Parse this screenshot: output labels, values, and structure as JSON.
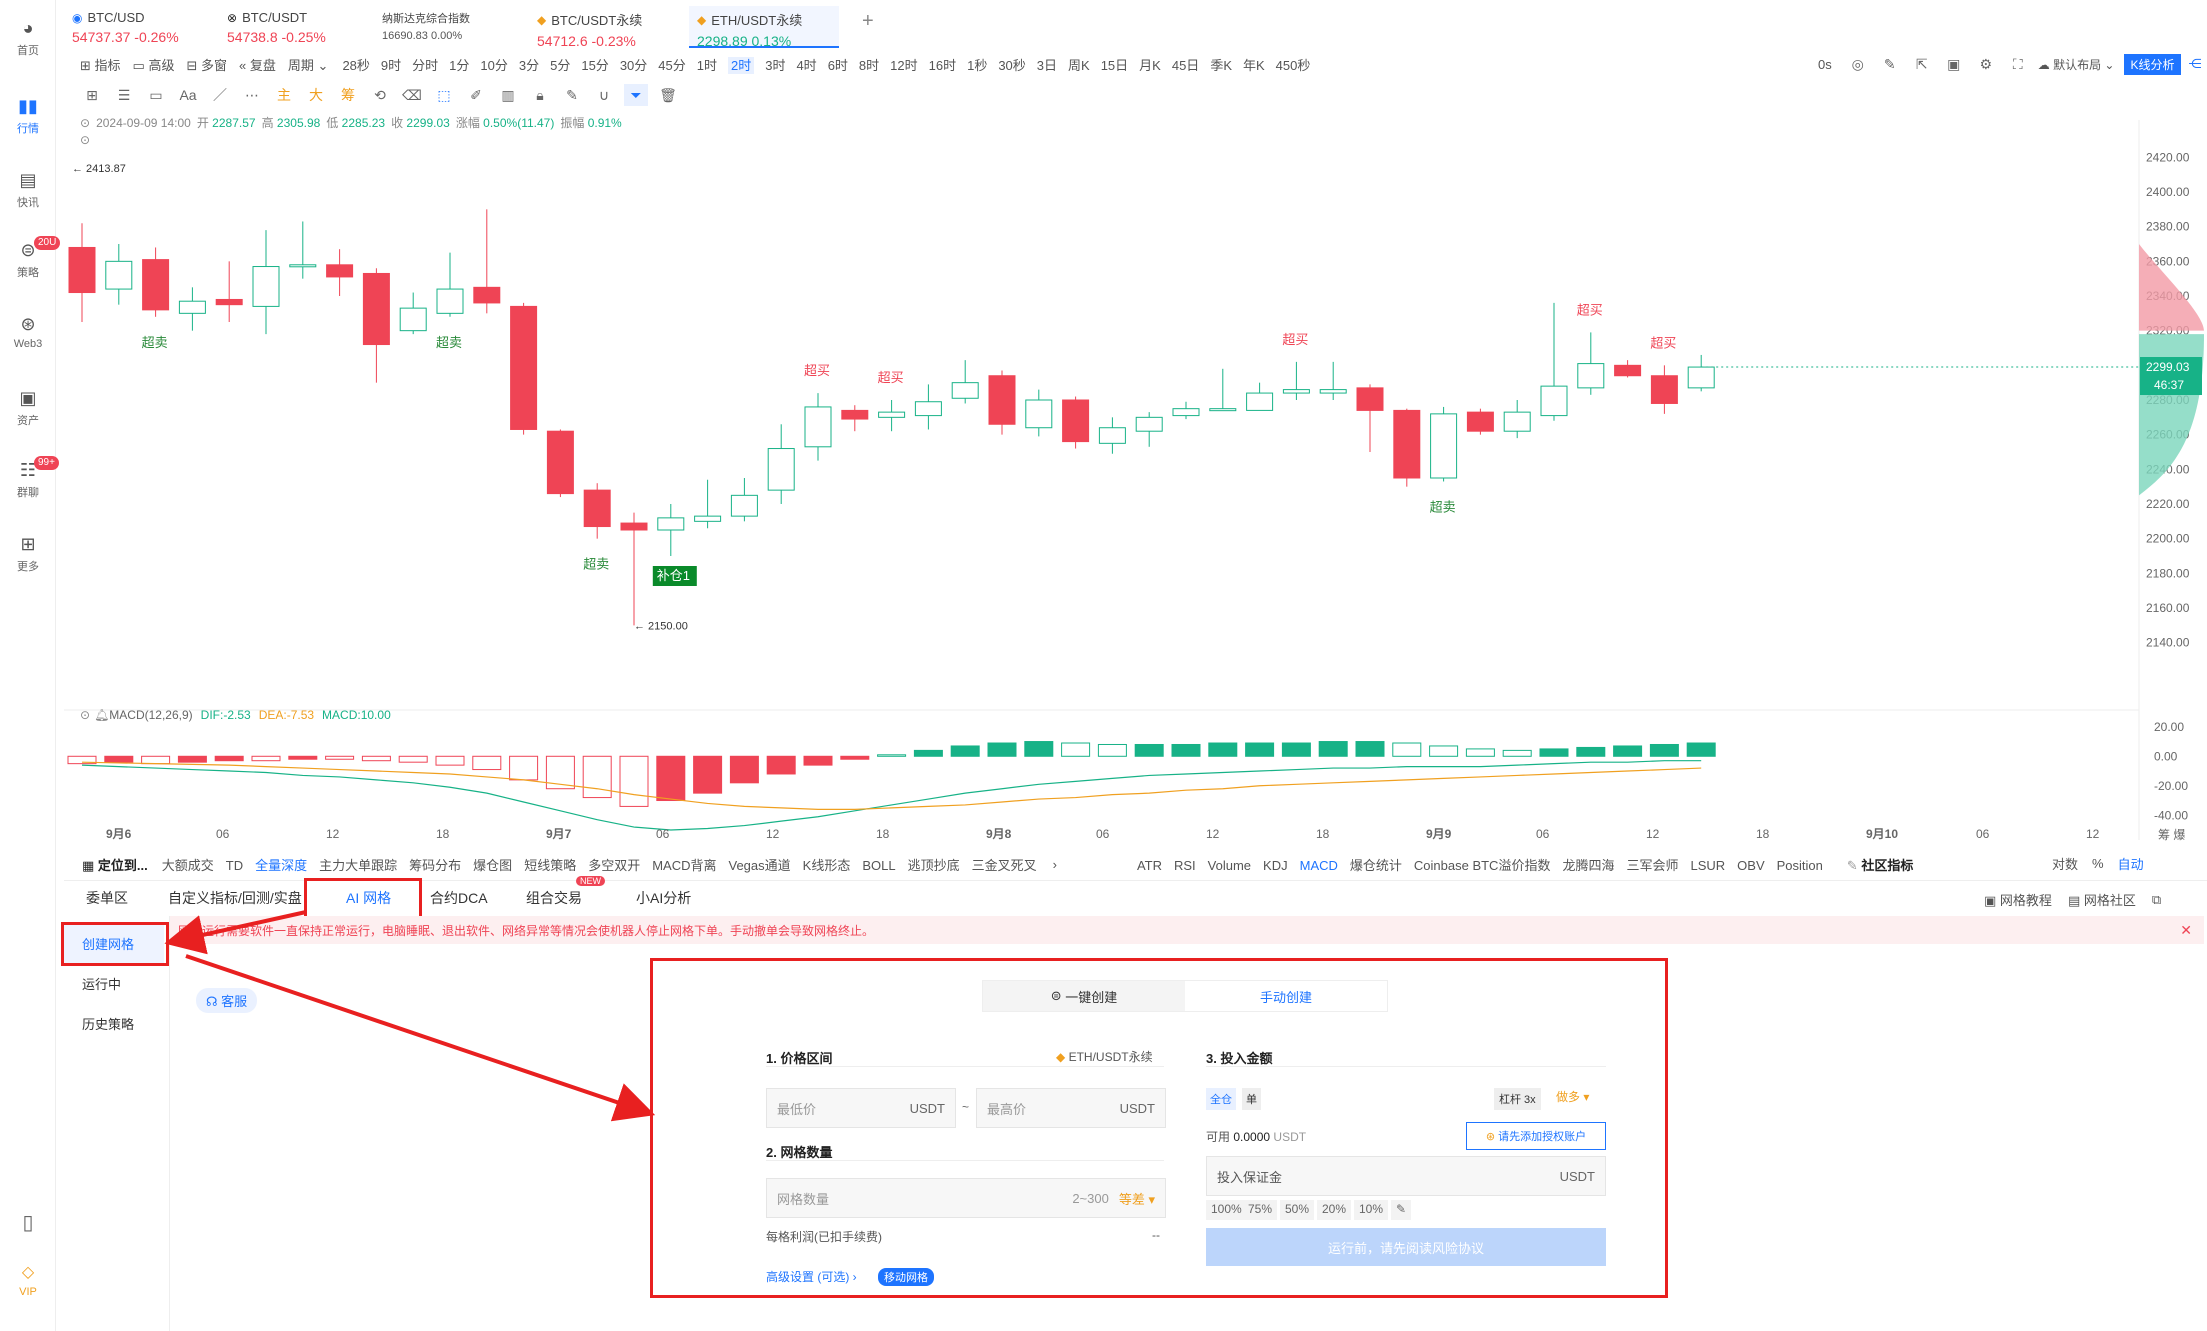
{
  "nav": [
    {
      "label": "首页",
      "icon": "home-icon"
    },
    {
      "label": "行情",
      "icon": "chart-bars-icon",
      "active": true
    },
    {
      "label": "快讯",
      "icon": "news-icon"
    },
    {
      "label": "策略",
      "icon": "robot-icon",
      "badge": "20U"
    },
    {
      "label": "Web3",
      "icon": "web3-icon"
    },
    {
      "label": "资产",
      "icon": "wallet-icon"
    },
    {
      "label": "群聊",
      "icon": "chat-icon",
      "badge": "99+"
    },
    {
      "label": "更多",
      "icon": "grid-icon"
    }
  ],
  "nav_bottom": {
    "vip": "VIP"
  },
  "tickers": [
    {
      "name": "BTC/USD",
      "price": "54737.37",
      "change": "-0.26%",
      "dir": "dn"
    },
    {
      "name": "BTC/USDT",
      "price": "54738.8",
      "change": "-0.25%",
      "dir": "dn"
    },
    {
      "name": "纳斯达克综合指数",
      "price": "16690.83",
      "change": "0.00%",
      "dir": "none"
    },
    {
      "name": "BTC/USDT永续",
      "price": "54712.6",
      "change": "-0.23%",
      "dir": "dn"
    },
    {
      "name": "ETH/USDT永续",
      "price": "2298.89",
      "change": "0.13%",
      "dir": "up",
      "active": true
    }
  ],
  "add_tab": "+",
  "toolbar1": {
    "indicators": "指标",
    "advanced": "高级",
    "multi": "多窗",
    "replay": "复盘",
    "period": "周期",
    "intervals": [
      "28秒",
      "9时",
      "分时",
      "1分",
      "10分",
      "3分",
      "5分",
      "15分",
      "30分",
      "45分",
      "1时",
      "2时",
      "3时",
      "4时",
      "6时",
      "8时",
      "12时",
      "16时",
      "1秒",
      "30秒",
      "3日",
      "周K",
      "15日",
      "月K",
      "45日",
      "季K",
      "年K",
      "450秒"
    ],
    "active_interval": "2时",
    "countdown": "0s",
    "layout": "默认布局",
    "kline_btn": "K线分析"
  },
  "toolbar2": {
    "t1": "Aa",
    "t2": "主",
    "t3": "大",
    "t4": "筹"
  },
  "ohlc": {
    "date": "2024-09-09 14:00",
    "open_l": "开",
    "open": "2287.57",
    "high_l": "高",
    "high": "2305.98",
    "low_l": "低",
    "low": "2285.23",
    "close_l": "收",
    "close": "2299.03",
    "chg_l": "涨幅",
    "chg": "0.50%(11.47)",
    "amp_l": "振幅",
    "amp": "0.91%"
  },
  "price_labels": {
    "high": "2413.87",
    "low": "2150.00",
    "current": "2299.03",
    "timer": "46:37"
  },
  "macd_header": {
    "name": "MACD(12,26,9)",
    "dif": "DIF:-2.53",
    "dea": "DEA:-7.53",
    "macd": "MACD:10.00"
  },
  "chart_data": {
    "type": "candlestick",
    "interval": "2h",
    "candles": [
      [
        2368,
        2342,
        2382,
        2325
      ],
      [
        2344,
        2360,
        2370,
        2335
      ],
      [
        2361,
        2332,
        2368,
        2328
      ],
      [
        2330,
        2337,
        2345,
        2320
      ],
      [
        2338,
        2335,
        2360,
        2325
      ],
      [
        2334,
        2357,
        2378,
        2318
      ],
      [
        2358,
        2358,
        2383,
        2350
      ],
      [
        2358,
        2351,
        2367,
        2340
      ],
      [
        2353,
        2312,
        2356,
        2290
      ],
      [
        2320,
        2333,
        2342,
        2318
      ],
      [
        2330,
        2344,
        2365,
        2328
      ],
      [
        2345,
        2336,
        2390,
        2330
      ],
      [
        2334,
        2263,
        2336,
        2260
      ],
      [
        2262,
        2226,
        2263,
        2224
      ],
      [
        2228,
        2207,
        2232,
        2200
      ],
      [
        2209,
        2205,
        2215,
        2150
      ],
      [
        2205,
        2212,
        2220,
        2190
      ],
      [
        2210,
        2213,
        2234,
        2206
      ],
      [
        2213,
        2225,
        2235,
        2210
      ],
      [
        2228,
        2252,
        2266,
        2220
      ],
      [
        2253,
        2276,
        2284,
        2245
      ],
      [
        2274,
        2269,
        2277,
        2262
      ],
      [
        2270,
        2273,
        2280,
        2262
      ],
      [
        2271,
        2279,
        2289,
        2263
      ],
      [
        2281,
        2290,
        2303,
        2278
      ],
      [
        2294,
        2266,
        2297,
        2260
      ],
      [
        2264,
        2280,
        2286,
        2259
      ],
      [
        2280,
        2256,
        2282,
        2252
      ],
      [
        2255,
        2264,
        2270,
        2249
      ],
      [
        2262,
        2270,
        2273,
        2253
      ],
      [
        2271,
        2275,
        2279,
        2269
      ],
      [
        2275,
        2275,
        2298,
        2274
      ],
      [
        2274,
        2284,
        2290,
        2274
      ],
      [
        2284,
        2286,
        2302,
        2280
      ],
      [
        2284,
        2286,
        2302,
        2280
      ],
      [
        2287,
        2274,
        2289,
        2250
      ],
      [
        2274,
        2235,
        2275,
        2230
      ],
      [
        2235,
        2272,
        2276,
        2233
      ],
      [
        2273,
        2262,
        2275,
        2260
      ],
      [
        2262,
        2273,
        2280,
        2258
      ],
      [
        2271,
        2288,
        2336,
        2268
      ],
      [
        2287,
        2301,
        2319,
        2283
      ],
      [
        2300,
        2294,
        2303,
        2293
      ],
      [
        2294,
        2278,
        2300,
        2272
      ],
      [
        2287,
        2299,
        2306,
        2285
      ]
    ],
    "x_ticks": [
      "9月6",
      "06",
      "12",
      "18",
      "9月7",
      "06",
      "12",
      "18",
      "9月8",
      "06",
      "12",
      "18",
      "9月9",
      "06",
      "12",
      "18",
      "9月10",
      "06",
      "12"
    ],
    "y_ticks": [
      "2420.00",
      "2400.00",
      "2380.00",
      "2360.00",
      "2340.00",
      "2320.00",
      "2300.00",
      "2280.00",
      "2260.00",
      "2240.00",
      "2220.00",
      "2200.00",
      "2180.00",
      "2160.00",
      "2140.00"
    ],
    "ylim": [
      2130,
      2430
    ],
    "macd_y_ticks": [
      "20.00",
      "0.00",
      "-20.00",
      "-40.00"
    ],
    "macd_ylim": [
      -50,
      28
    ],
    "macd_hist": [
      -5,
      -4,
      -5,
      -4,
      -3,
      -3,
      -2,
      -2,
      -3,
      -4,
      -6,
      -9,
      -16,
      -22,
      -28,
      -34,
      -30,
      -25,
      -18,
      -12,
      -6,
      -2,
      1,
      4,
      7,
      9,
      10,
      9,
      8,
      8,
      8,
      9,
      9,
      9,
      10,
      10,
      9,
      7,
      5,
      4,
      5,
      6,
      7,
      8,
      9,
      10
    ],
    "macd_dif": [
      -6,
      -7,
      -8,
      -9,
      -10,
      -11,
      -13,
      -14,
      -16,
      -18,
      -21,
      -25,
      -31,
      -37,
      -43,
      -48,
      -50,
      -49,
      -47,
      -44,
      -41,
      -37,
      -33,
      -29,
      -25,
      -22,
      -19,
      -17,
      -15,
      -13,
      -12,
      -11,
      -10,
      -9,
      -8,
      -8,
      -7,
      -7,
      -7,
      -6,
      -5,
      -4,
      -4,
      -3,
      -3,
      -2.5
    ],
    "macd_dea": [
      -4,
      -4.5,
      -5,
      -5.5,
      -6,
      -7,
      -8,
      -9,
      -10,
      -11,
      -12,
      -14,
      -16,
      -19,
      -22,
      -26,
      -29,
      -32,
      -34,
      -35,
      -36,
      -36,
      -35,
      -34,
      -33,
      -31,
      -29,
      -28,
      -26,
      -25,
      -23,
      -22,
      -20,
      -19,
      -18,
      -17,
      -16,
      -15,
      -14,
      -13,
      -12,
      -11,
      -10,
      -9,
      -8,
      -7.5
    ],
    "signals": [
      {
        "text": "超卖",
        "i": 2,
        "pos": "below",
        "color": "green"
      },
      {
        "text": "超卖",
        "i": 10,
        "pos": "below",
        "color": "green"
      },
      {
        "text": "超卖",
        "i": 14,
        "pos": "below",
        "color": "green"
      },
      {
        "text": "超买",
        "i": 20,
        "pos": "above",
        "color": "red"
      },
      {
        "text": "超买",
        "i": 22,
        "pos": "above",
        "color": "red"
      },
      {
        "text": "超买",
        "i": 33,
        "pos": "above",
        "color": "red"
      },
      {
        "text": "超卖",
        "i": 37,
        "pos": "below",
        "color": "green"
      },
      {
        "text": "超买",
        "i": 41,
        "pos": "above",
        "color": "red"
      },
      {
        "text": "超买",
        "i": 43,
        "pos": "above",
        "color": "red"
      }
    ],
    "refill_label": "补仓1"
  },
  "indicator_bar": {
    "locate": "定位到...",
    "left": [
      "大额成交",
      "TD",
      "全量深度",
      "主力大单跟踪",
      "筹码分布",
      "爆仓图",
      "短线策略",
      "多空双开",
      "MACD背离",
      "Vegas通道",
      "K线形态",
      "BOLL",
      "逃顶抄底",
      "三金叉死叉"
    ],
    "right": [
      "ATR",
      "RSI",
      "Volume",
      "KDJ",
      "MACD",
      "爆仓统计",
      "Coinbase BTC溢价指数",
      "龙腾四海",
      "三军会师",
      "LSUR",
      "OBV",
      "Position"
    ],
    "community": "社区指标",
    "log": "对数",
    "pct": "%",
    "auto": "自动",
    "corner": "筹 爆"
  },
  "bottom_tabs": [
    "委单区",
    "自定义指标/回测/实盘",
    "AI 网格",
    "合约DCA",
    "组合交易",
    "小AI分析"
  ],
  "new_badge": "NEW",
  "bottom_right": {
    "tutorial": "网格教程",
    "community": "网格社区"
  },
  "warning": "网格运行需要软件一直保持正常运行，电脑睡眠、退出软件、网络异常等情况会使机器人停止网格下单。手动撤单会导致网格终止。",
  "side_menu": [
    "创建网格",
    "运行中",
    "历史策略"
  ],
  "service": "客服",
  "form": {
    "mode_tabs": [
      "一键创建",
      "手动创建"
    ],
    "sec1": "1. 价格区间",
    "pair": "ETH/USDT永续",
    "low_ph": "最低价",
    "high_ph": "最高价",
    "usdt": "USDT",
    "tilde": "~",
    "sec2": "2. 网格数量",
    "grid_ph": "网格数量",
    "grid_range": "2~300",
    "grid_mode": "等差",
    "profit_label": "每格利润(已扣手续费)",
    "profit_val": "--",
    "advanced": "高级设置 (可选)",
    "moving": "移动网格",
    "sec3": "3. 投入金额",
    "margin_all": "全仓",
    "margin_single": "单",
    "leverage": "杠杆 3x",
    "direction": "做多",
    "avail_label": "可用",
    "avail_val": "0.0000",
    "avail_unit": "USDT",
    "auth_btn": "请先添加授权账户",
    "margin_ph": "投入保证金",
    "pcts": [
      "100%",
      "75%",
      "50%",
      "20%",
      "10%"
    ],
    "submit": "运行前，请先阅读风险协议"
  }
}
